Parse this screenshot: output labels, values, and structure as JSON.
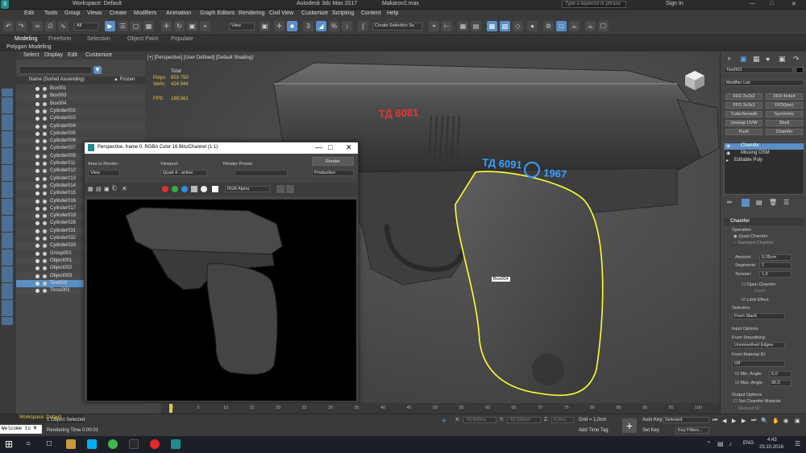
{
  "titlebar": {
    "workspace": "Workspace: Default",
    "app_title": "Autodesk 3ds Max 2017",
    "file_name": "Makarov2.max",
    "search_placeholder": "Type a keyword or phrase",
    "sign_in": "Sign In"
  },
  "menu": [
    "Edit",
    "Tools",
    "Group",
    "Views",
    "Create",
    "Modifiers",
    "Animation",
    "Graph Editors",
    "Rendering",
    "Civil View",
    "Customize",
    "Scripting",
    "Content",
    "Help"
  ],
  "toolbar": {
    "filter_select": "All",
    "view_select": "View",
    "selection_set": "Create Selection Se"
  },
  "ribbon": {
    "tabs": [
      "Modeling",
      "Freeform",
      "Selection",
      "Object Paint",
      "Populate"
    ],
    "sub": "Polygon Modeling"
  },
  "scene_explorer": {
    "menu": [
      "Select",
      "Display",
      "Edit",
      "Customize"
    ],
    "col_name": "Name (Sorted Ascending)",
    "col_frozen": "▲ Frozen",
    "items": [
      "Box001",
      "Box003",
      "Box004",
      "Cylinder002",
      "Cylinder003",
      "Cylinder004",
      "Cylinder005",
      "Cylinder006",
      "Cylinder007",
      "Cylinder009",
      "Cylinder011",
      "Cylinder012",
      "Cylinder013",
      "Cylinder014",
      "Cylinder015",
      "Cylinder016",
      "Cylinder017",
      "Cylinder019",
      "Cylinder028",
      "Cylinder031",
      "Cylinder032",
      "Cylinder033",
      "Group001",
      "Object001",
      "Object002",
      "Object003",
      "Text003",
      "Torus001"
    ],
    "selected": "Text003"
  },
  "viewport": {
    "label": "[+] [Perspective] [User Defined] [Default Shading]",
    "stats_total": "Total",
    "polys_label": "Polys:",
    "polys_value": "853 750",
    "verts_label": "Verts:",
    "verts_value": "424 944",
    "fps_label": "FPS:",
    "fps_value": "189,561",
    "obj_tag": "Box004",
    "slide_text": "ТД 6081",
    "grip_text": "ТД 6091",
    "year_text": "1967"
  },
  "render_window": {
    "title": "Perspective, frame 0, RGBA Color 16 Bits/Channel (1:1)",
    "area_label": "Area to Render:",
    "area_value": "View",
    "viewport_label": "Viewport:",
    "viewport_value": "Quad 4 - active",
    "preset_label": "Render Preset:",
    "preset_value": "",
    "render_btn": "Render",
    "production": "Production",
    "channel": "RGB Alpha"
  },
  "command_panel": {
    "object_name": "Text003",
    "modifier_list": "Modifier List",
    "buttons": [
      "FFD 2x2x2",
      "FFD 4x4x4",
      "FFD 3x3x3",
      "FFD(box)",
      "TurboSmooth",
      "Symmetry",
      "Unwrap UVW",
      "Shell",
      "Push",
      "Chamfer"
    ],
    "stack": [
      "Chamfer",
      "Missing OSM",
      "Editable Poly"
    ],
    "rollout": "Chamfer",
    "operation": "Operation",
    "quad_chamfer": "Quad Chamfer",
    "standard_chamfer": "Standard Chamfer",
    "amount_label": "Amount:",
    "amount": "0,05cm",
    "segments_label": "Segments:",
    "segments": "1",
    "tension_label": "Tension:",
    "tension": "1,0",
    "open_chamfer": "Open Chamfer",
    "invert": "Invert",
    "limit_effect": "Limit Effect",
    "selection": "Selection",
    "from_stack": "From Stack",
    "input_options": "Input Options",
    "from_smoothing": "From Smoothing:",
    "unsmoothed": "Unsmoothed Edges",
    "from_material": "From Material ID:",
    "off": "Off",
    "min_angle_label": "Min. Angle:",
    "min_angle": "5,0",
    "max_angle_label": "Max. Angle:",
    "max_angle": "90,0",
    "output_options": "Output Options",
    "set_chamfer_mat": "Set Chamfer Material",
    "material_id": "Material ID:"
  },
  "timeline": {
    "frame": "0 / 100",
    "ticks": [
      "0",
      "5",
      "10",
      "15",
      "20",
      "25",
      "30",
      "35",
      "40",
      "45",
      "50",
      "55",
      "60",
      "65",
      "70",
      "75",
      "80",
      "85",
      "90",
      "95",
      "100"
    ]
  },
  "status": {
    "workspace": "Workspace: Default",
    "welcome": "Welcome to M",
    "selected": "1 Object Selected",
    "rendering_time": "Rendering Time  0:00:01",
    "x_label": "X:",
    "x_value": "-16,430cm",
    "y_label": "Y:",
    "y_value": "-87,636cm",
    "z_label": "Z:",
    "z_value": "0,0cm",
    "grid": "Grid = 1,0cm",
    "add_time_tag": "Add Time Tag",
    "auto_key": "Auto Key",
    "selected_set": "Selected",
    "set_key": "Set Key",
    "key_filters": "Key Filters..."
  },
  "taskbar": {
    "lang": "ENG",
    "time": "4:43",
    "date": "29.10.2016"
  }
}
